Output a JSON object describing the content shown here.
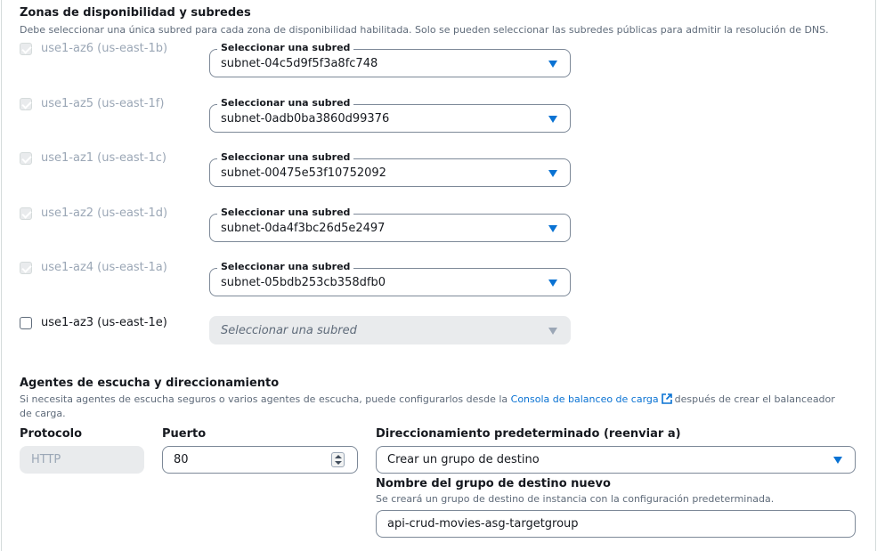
{
  "az_section": {
    "title": "Zonas de disponibilidad y subredes",
    "description": "Debe seleccionar una única subred para cada zona de disponibilidad habilitada. Solo se pueden seleccionar las subredes públicas para admitir la resolución de DNS.",
    "select_legend": "Seleccionar una subred",
    "rows": [
      {
        "label": "use1-az6 (us-east-1b)",
        "checked": true,
        "disabled": true,
        "subnet": "subnet-04c5d9f5f3a8fc748"
      },
      {
        "label": "use1-az5 (us-east-1f)",
        "checked": true,
        "disabled": true,
        "subnet": "subnet-0adb0ba3860d99376"
      },
      {
        "label": "use1-az1 (us-east-1c)",
        "checked": true,
        "disabled": true,
        "subnet": "subnet-00475e53f10752092"
      },
      {
        "label": "use1-az2 (us-east-1d)",
        "checked": true,
        "disabled": true,
        "subnet": "subnet-0da4f3bc26d5e2497"
      },
      {
        "label": "use1-az4 (us-east-1a)",
        "checked": true,
        "disabled": true,
        "subnet": "subnet-05bdb253cb358dfb0"
      },
      {
        "label": "use1-az3 (us-east-1e)",
        "checked": false,
        "disabled": false,
        "subnet_placeholder": "Seleccionar una subred"
      }
    ]
  },
  "listeners_section": {
    "title": "Agentes de escucha y direccionamiento",
    "description_before": "Si necesita agentes de escucha seguros o varios agentes de escucha, puede configurarlos desde la",
    "console_link": "Consola de balanceo de carga",
    "description_after": "después de crear el balanceador de carga.",
    "protocol_label": "Protocolo",
    "protocol_value": "HTTP",
    "port_label": "Puerto",
    "port_value": "80",
    "routing_label": "Direccionamiento predeterminado (reenviar a)",
    "routing_value": "Crear un grupo de destino",
    "target_group_label": "Nombre del grupo de destino nuevo",
    "target_group_desc": "Se creará un grupo de destino de instancia con la configuración predeterminada.",
    "target_group_value": "api-crud-movies-asg-targetgroup"
  },
  "colors": {
    "accent": "#0972d3",
    "text": "#16191f",
    "muted": "#5f6b7a",
    "disabled_bg": "#e9ebed"
  }
}
